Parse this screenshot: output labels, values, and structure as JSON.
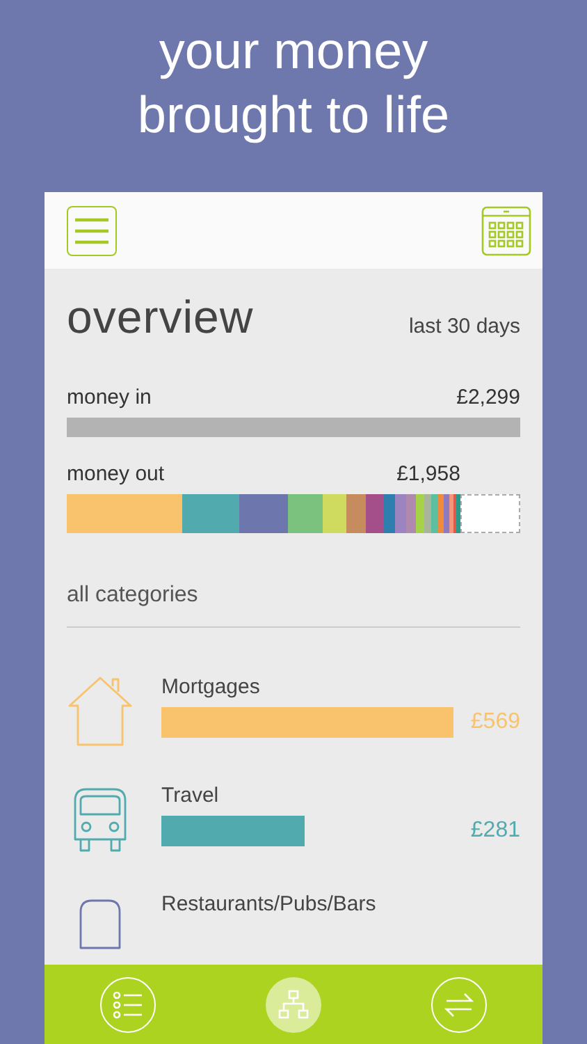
{
  "headline": "your money brought to life",
  "overview": {
    "title": "overview",
    "period": "last 30 days",
    "money_in": {
      "label": "money in",
      "amount": "£2,299"
    },
    "money_out": {
      "label": "money out",
      "amount": "£1,958",
      "segments": [
        {
          "color": "#f8c36c"
        },
        {
          "color": "#51aaae"
        },
        {
          "color": "#6e76ae"
        },
        {
          "color": "#7ac27e"
        },
        {
          "color": "#cfdb5e"
        },
        {
          "color": "#c68c5e"
        },
        {
          "color": "#a44f8a"
        },
        {
          "color": "#2e7eae"
        },
        {
          "color": "#9c84c0"
        },
        {
          "color": "#b08aae"
        },
        {
          "color": "#a6d24a"
        },
        {
          "color": "#a8b59a"
        },
        {
          "color": "#5cbfa0"
        },
        {
          "color": "#f08a3c"
        },
        {
          "color": "#8e7abe"
        },
        {
          "color": "#f4967a"
        },
        {
          "color": "#e05a4a"
        },
        {
          "color": "#2a9a8a"
        }
      ]
    }
  },
  "categories_heading": "all categories",
  "categories": [
    {
      "name": "Mortgages",
      "amount": "£569",
      "color": "#f8c36c"
    },
    {
      "name": "Travel",
      "amount": "£281",
      "color": "#51aaae"
    },
    {
      "name": "Restaurants/Pubs/Bars",
      "color": "#6e76ae"
    }
  ],
  "nav": [
    {
      "selected": false
    },
    {
      "selected": true
    },
    {
      "selected": false
    }
  ]
}
